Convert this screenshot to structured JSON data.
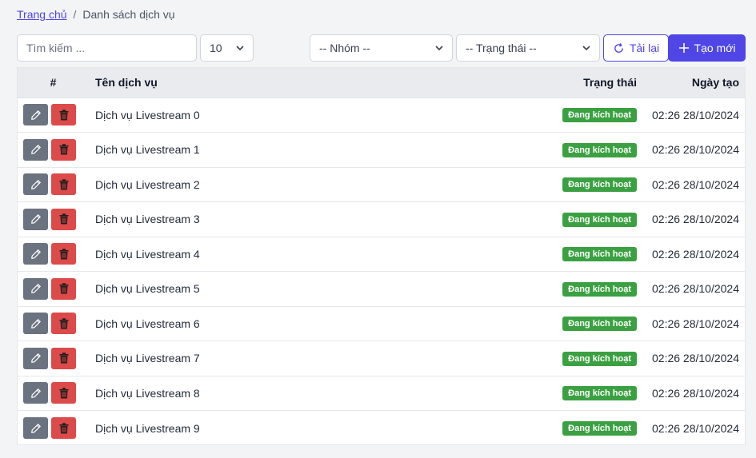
{
  "breadcrumb": {
    "home": "Trang chủ",
    "separator": "/",
    "current": "Danh sách dịch vụ"
  },
  "toolbar": {
    "search_placeholder": "Tìm kiếm ...",
    "per_page": "10",
    "group_select": "-- Nhóm --",
    "status_select": "-- Trạng thái --",
    "reload_label": "Tải lại",
    "create_label": "Tạo mới"
  },
  "table": {
    "headers": {
      "index": "#",
      "name": "Tên dịch vụ",
      "status": "Trạng thái",
      "created": "Ngày tạo"
    },
    "rows": [
      {
        "name": "Dịch vụ Livestream 0",
        "status": "Đang kích hoạt",
        "created": "02:26 28/10/2024"
      },
      {
        "name": "Dịch vụ Livestream 1",
        "status": "Đang kích hoạt",
        "created": "02:26 28/10/2024"
      },
      {
        "name": "Dịch vụ Livestream 2",
        "status": "Đang kích hoạt",
        "created": "02:26 28/10/2024"
      },
      {
        "name": "Dịch vụ Livestream 3",
        "status": "Đang kích hoạt",
        "created": "02:26 28/10/2024"
      },
      {
        "name": "Dịch vụ Livestream 4",
        "status": "Đang kích hoạt",
        "created": "02:26 28/10/2024"
      },
      {
        "name": "Dịch vụ Livestream 5",
        "status": "Đang kích hoạt",
        "created": "02:26 28/10/2024"
      },
      {
        "name": "Dịch vụ Livestream 6",
        "status": "Đang kích hoạt",
        "created": "02:26 28/10/2024"
      },
      {
        "name": "Dịch vụ Livestream 7",
        "status": "Đang kích hoạt",
        "created": "02:26 28/10/2024"
      },
      {
        "name": "Dịch vụ Livestream 8",
        "status": "Đang kích hoạt",
        "created": "02:26 28/10/2024"
      },
      {
        "name": "Dịch vụ Livestream 9",
        "status": "Đang kích hoạt",
        "created": "02:26 28/10/2024"
      }
    ]
  },
  "colors": {
    "accent": "#4f46e5",
    "active_badge": "#3ba042",
    "edit_button": "#6b7280",
    "delete_button": "#dc4a4a"
  },
  "icons": {
    "edit": "pencil-icon",
    "delete": "trash-icon",
    "reload": "refresh-icon",
    "create": "plus-icon",
    "dropdown": "chevron-down-icon"
  }
}
